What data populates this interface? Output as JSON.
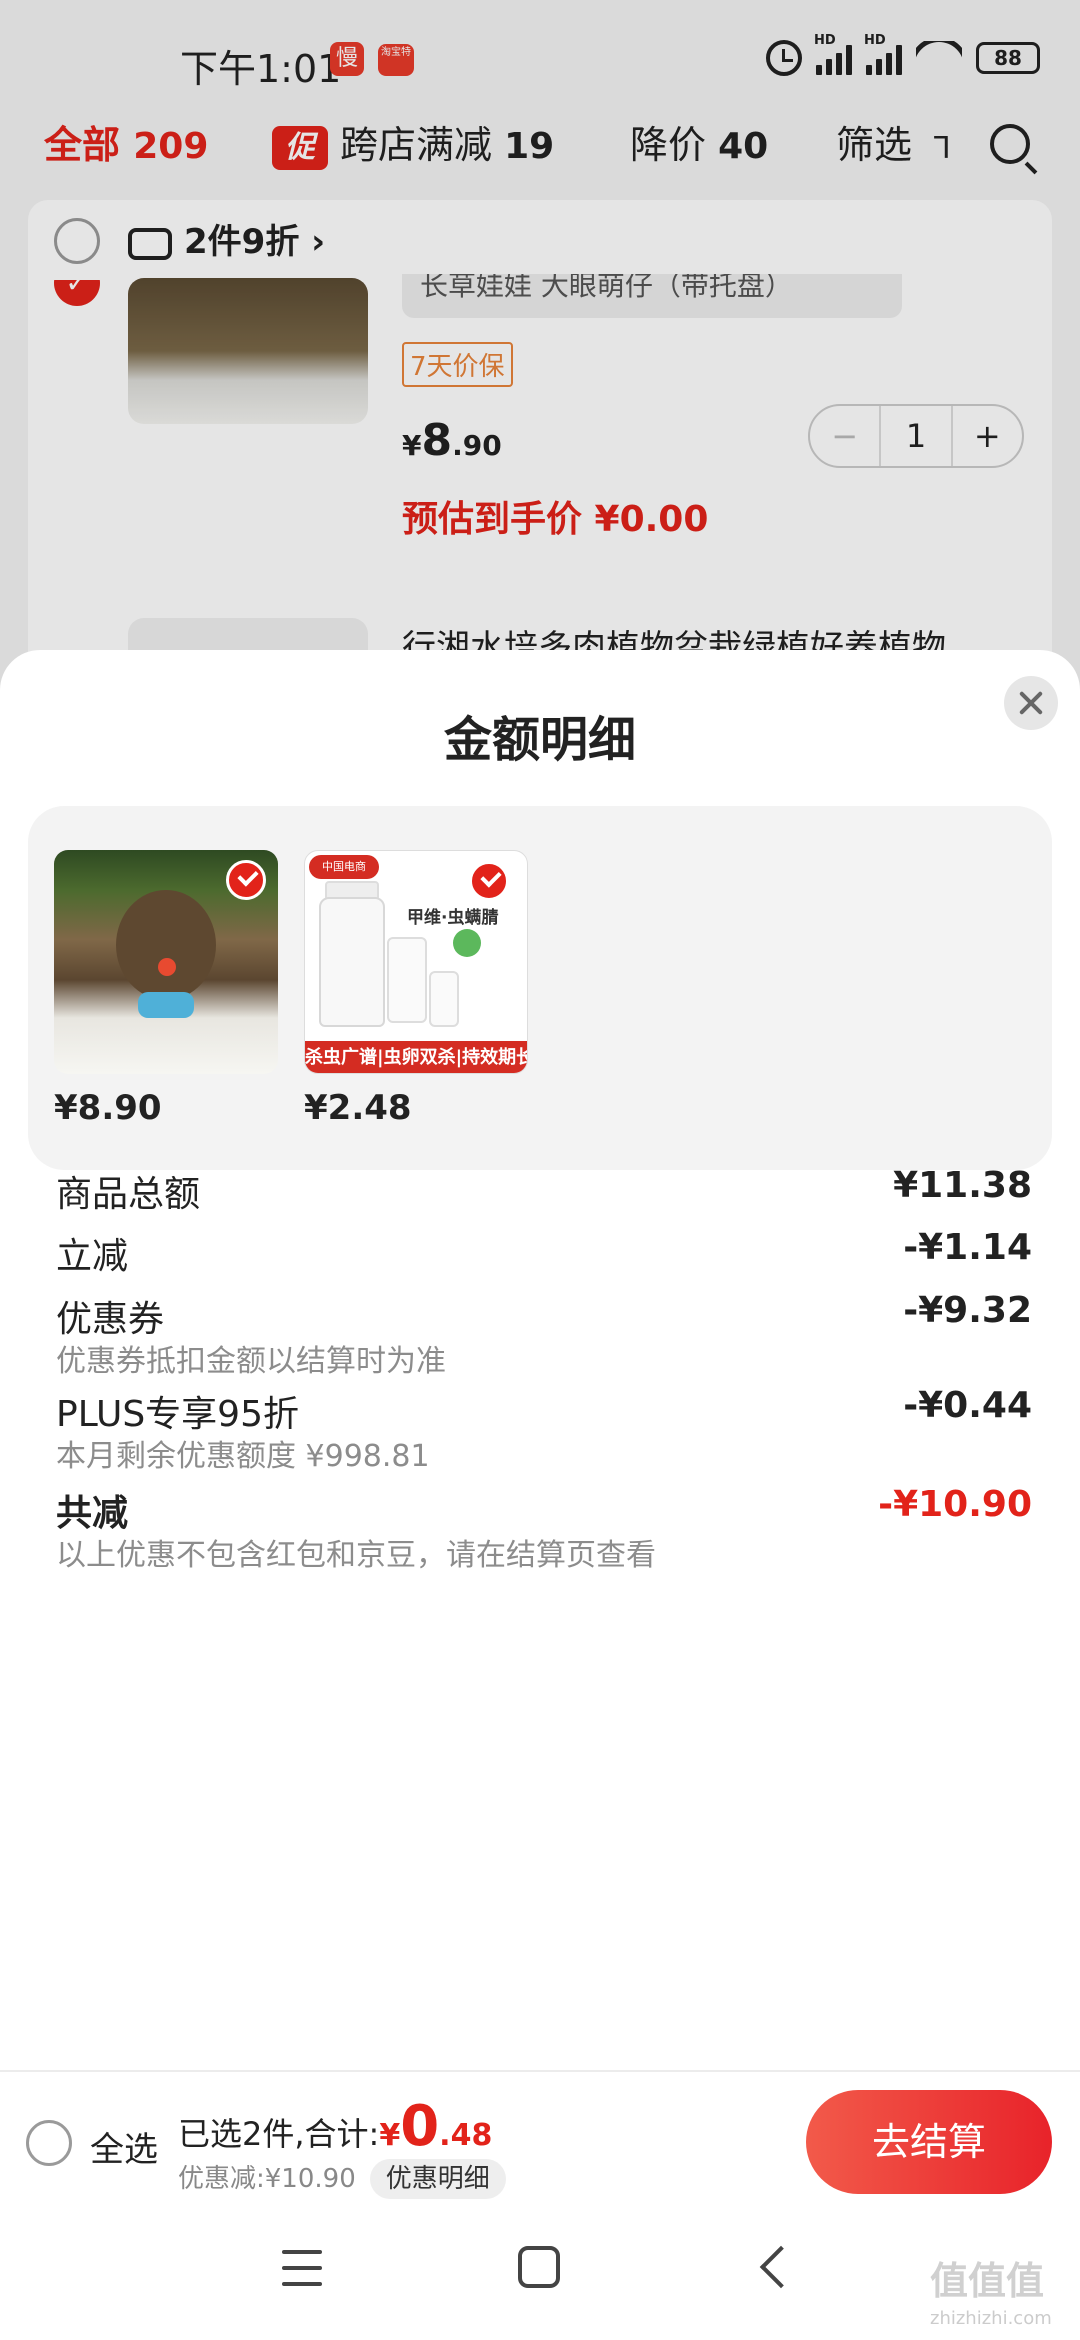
{
  "status_bar": {
    "time": "下午1:01",
    "app_badge_1": "慢",
    "app_badge_2": "淘宝特",
    "battery": "88"
  },
  "tabs": [
    {
      "label": "全部",
      "count": "209"
    },
    {
      "label": "跨店满减",
      "count": "19",
      "badge": "促"
    },
    {
      "label": "降价",
      "count": "40"
    },
    {
      "label": "筛选"
    }
  ],
  "cart": {
    "group_header": "2件9折 ›",
    "item1": {
      "variant": "长草娃娃 大眼萌仔（带托盘）",
      "tag": "7天价保",
      "price_symbol": "¥",
      "price_int": "8",
      "price_dec": ".90",
      "estimate": "预估到手价 ¥0.00",
      "qty": "1",
      "minus": "−",
      "plus": "+"
    },
    "item2": {
      "title": "行湘水培多肉植物盆栽绿植好养植物"
    }
  },
  "sheet": {
    "title": "金额明细",
    "thumbs": [
      {
        "price": "¥8.90"
      },
      {
        "price": "¥2.48",
        "brand_text": "甲维·虫螨腈",
        "banner": "杀虫广谱|虫卵双杀|持效期长",
        "logo": "中国电商"
      }
    ],
    "rows": [
      {
        "label": "商品总额",
        "value": "¥11.38"
      },
      {
        "label": "立减",
        "value": "-¥1.14"
      },
      {
        "label": "优惠券",
        "value": "-¥9.32",
        "note": "优惠券抵扣金额以结算时为准"
      },
      {
        "label": "PLUS专享95折",
        "value": "-¥0.44",
        "note": "本月剩余优惠额度 ¥998.81"
      },
      {
        "label": "共减",
        "value": "-¥10.90",
        "note": "以上优惠不包含红包和京豆，请在结算页查看"
      }
    ]
  },
  "bottom_bar": {
    "select_all": "全选",
    "selected_text": "已选2件,合计:",
    "total_symbol": "¥",
    "total_int": "0",
    "total_dec": ".48",
    "discount_text": "优惠减:¥10.90",
    "detail_chip": "优惠明细",
    "checkout": "去结算"
  },
  "watermark": {
    "text": "值值值",
    "sub": "zhizhizhi.com"
  },
  "colors": {
    "accent": "#e2231a",
    "sheet_bg": "#ffffff",
    "thumb_panel": "#f3f3f3"
  }
}
